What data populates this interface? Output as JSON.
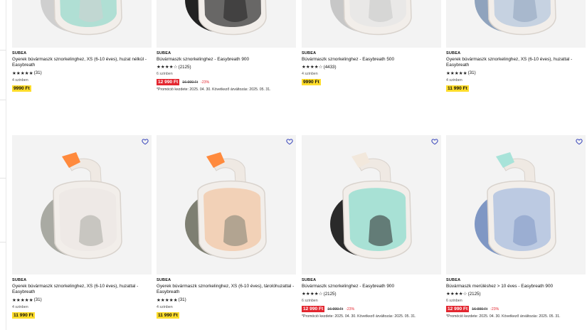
{
  "colors": {
    "accent": "#3643ba",
    "price_yellow": "#ffdd2b",
    "price_red": "#e3262f"
  },
  "icons": {
    "favorite": "heart-outline-icon",
    "star": "star-icon"
  },
  "products": [
    {
      "brand": "SUBEA",
      "title": "Gyerek búvármaszk sznorkelinghez, XS (6-10 éves), huzat nélkül - Easybreath",
      "stars": "★★★★★",
      "reviews": "(31)",
      "stock": "4 szinben",
      "price": "9990 Ft",
      "old_price": "",
      "discount": "",
      "promo": "",
      "mask_color": "#9ad9cc",
      "strap_color": "#cfcfcf"
    },
    {
      "brand": "SUBEA",
      "title": "Búvármaszk sznorkelinghez - Easybreath 900",
      "stars": "★★★★☆",
      "reviews": "(2125)",
      "stock": "6 szinben",
      "price": "12 990 Ft",
      "old_price": "16 990 Ft",
      "discount": "-23%",
      "promo": "*Promóció kezdete: 2025. 04. 30. Következő árváltozás: 2025. 05. 31.",
      "mask_color": "#3a3a3a",
      "strap_color": "#222"
    },
    {
      "brand": "SUBEA",
      "title": "Búvármaszk sznorkelinghez - Easybreath 500",
      "stars": "★★★★☆",
      "reviews": "(4433)",
      "stock": "4 szinben",
      "price": "9990 Ft",
      "old_price": "",
      "discount": "",
      "promo": "",
      "mask_color": "#e6e6e6",
      "strap_color": "#c7c7c7"
    },
    {
      "brand": "SUBEA",
      "title": "Gyerek búvármaszk sznorkelinghez, XS (6-10 éves), huzattal - Easybreath",
      "stars": "★★★★★",
      "reviews": "(31)",
      "stock": "4 szinben",
      "price": "11 990 Ft",
      "old_price": "",
      "discount": "",
      "promo": "",
      "mask_color": "#b7c8dd",
      "strap_color": "#8fa3bd"
    },
    {
      "brand": "SUBEA",
      "title": "Gyerek búvármaszk sznorkelinghez, XS (6-10 éves), huzattal - Easybreath",
      "stars": "★★★★★",
      "reviews": "(31)",
      "stock": "4 szinben",
      "price": "11 990 Ft",
      "old_price": "",
      "discount": "",
      "promo": "",
      "mask_color": "#ece7e4",
      "strap_color": "#a9aaa3",
      "snorkel_tip": "#ff8a3d"
    },
    {
      "brand": "SUBEA",
      "title": "Gyerek búvármaszk sznorkelinghez, XS (6-10 éves), tárolóhuzattal - Easybreath",
      "stars": "★★★★★",
      "reviews": "(31)",
      "stock": "4 szinben",
      "price": "11 990 Ft",
      "old_price": "",
      "discount": "",
      "promo": "",
      "mask_color": "#f1c7a6",
      "strap_color": "#7e7f72",
      "snorkel_tip": "#ff8a3d"
    },
    {
      "brand": "SUBEA",
      "title": "Búvármaszk sznorkelinghez - Easybreath 900",
      "stars": "★★★★☆",
      "reviews": "(2125)",
      "stock": "6 szinben",
      "price": "12 990 Ft",
      "old_price": "16 990 Ft",
      "discount": "-23%",
      "promo": "*Promóció kezdete: 2025. 04. 30. Következő árváltozás: 2025. 05. 31.",
      "mask_color": "#8fdccd",
      "strap_color": "#2a2a2a",
      "snorkel_tip": "#f2e8dc"
    },
    {
      "brand": "SUBEA",
      "title": "Búvármaszk merüléshez > 10 éves - Easybreath 900",
      "stars": "★★★★☆",
      "reviews": "(2125)",
      "stock": "6 szinben",
      "price": "12 990 Ft",
      "old_price": "16 990 Ft",
      "discount": "-23%",
      "promo": "*Promóció kezdete: 2025. 04. 30. Következő árváltozás: 2025. 05. 31.",
      "mask_color": "#a9bddf",
      "strap_color": "#7f97c4",
      "snorkel_tip": "#a8e3d9"
    }
  ]
}
